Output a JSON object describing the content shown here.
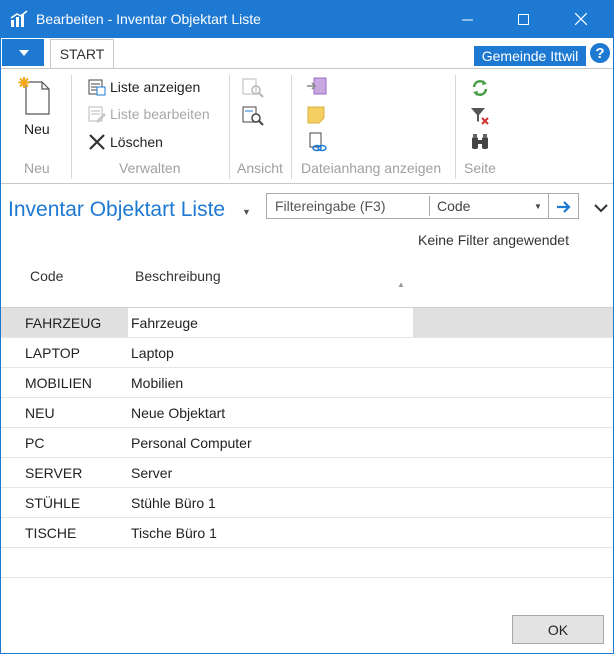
{
  "window": {
    "title": "Bearbeiten - Inventar Objektart Liste",
    "accent": "#1e79d2"
  },
  "ribbon": {
    "tab": "START",
    "company": "Gemeinde Ittwil",
    "help": "?",
    "new_label": "Neu",
    "groups": {
      "neu": "Neu",
      "verwalten": "Verwalten",
      "ansicht": "Ansicht",
      "dateianhang": "Dateianhang anzeigen",
      "seite": "Seite"
    },
    "verwalten_items": {
      "liste_anzeigen": "Liste anzeigen",
      "liste_bearbeiten": "Liste bearbeiten",
      "loeschen": "Löschen"
    }
  },
  "page": {
    "title": "Inventar Objektart Liste",
    "filter_placeholder": "Filtereingabe (F3)",
    "filter_field": "Code",
    "filter_status": "Keine Filter angewendet"
  },
  "table": {
    "columns": [
      "Code",
      "Beschreibung"
    ],
    "rows": [
      {
        "code": "FAHRZEUG",
        "desc": "Fahrzeuge"
      },
      {
        "code": "LAPTOP",
        "desc": "Laptop"
      },
      {
        "code": "MOBILIEN",
        "desc": "Mobilien"
      },
      {
        "code": "NEU",
        "desc": "Neue Objektart"
      },
      {
        "code": "PC",
        "desc": "Personal Computer"
      },
      {
        "code": "SERVER",
        "desc": "Server"
      },
      {
        "code": "STÜHLE",
        "desc": "Stühle Büro 1"
      },
      {
        "code": "TISCHE",
        "desc": "Tische Büro 1"
      }
    ],
    "selected_row": 0
  },
  "footer": {
    "ok": "OK"
  }
}
